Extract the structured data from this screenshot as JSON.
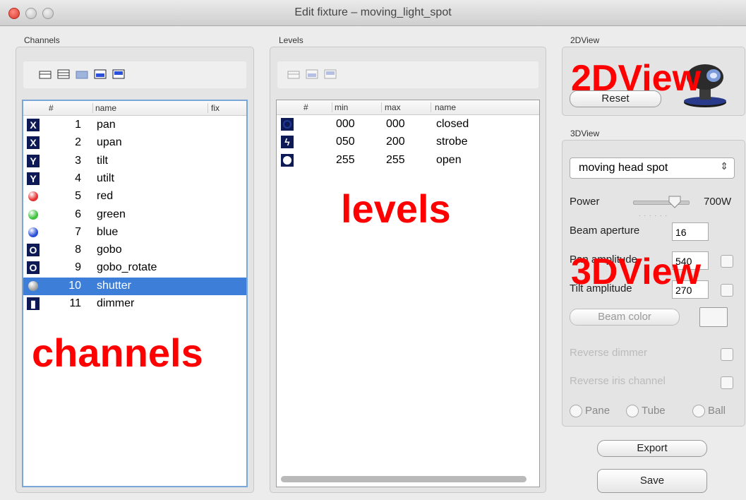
{
  "window": {
    "title": "Edit fixture – moving_light_spot"
  },
  "channels": {
    "group_label": "Channels",
    "columns": [
      "#",
      "name",
      "fix"
    ],
    "rows": [
      {
        "num": "1",
        "name": "pan",
        "icon": "x-axis-icon",
        "glyph": "X"
      },
      {
        "num": "2",
        "name": "upan",
        "icon": "x-fine-icon",
        "glyph": "X"
      },
      {
        "num": "3",
        "name": "tilt",
        "icon": "y-axis-icon",
        "glyph": "Y"
      },
      {
        "num": "4",
        "name": "utilt",
        "icon": "y-fine-icon",
        "glyph": "Y"
      },
      {
        "num": "5",
        "name": "red",
        "icon": "red-ball-icon",
        "color": "#e53030"
      },
      {
        "num": "6",
        "name": "green",
        "icon": "green-ball-icon",
        "color": "#3cc23c"
      },
      {
        "num": "7",
        "name": "blue",
        "icon": "blue-ball-icon",
        "color": "#2a4fd8"
      },
      {
        "num": "8",
        "name": "gobo",
        "icon": "gobo-icon",
        "glyph": "O"
      },
      {
        "num": "9",
        "name": "gobo_rotate",
        "icon": "gobo-rotate-icon",
        "glyph": "O"
      },
      {
        "num": "10",
        "name": "shutter",
        "icon": "shutter-icon",
        "selected": true
      },
      {
        "num": "11",
        "name": "dimmer",
        "icon": "dimmer-icon",
        "glyph": "▮"
      }
    ],
    "overlay_label": "channels"
  },
  "levels": {
    "group_label": "Levels",
    "columns": [
      "#",
      "min",
      "max",
      "name"
    ],
    "rows": [
      {
        "min": "000",
        "max": "000",
        "name": "closed",
        "icon": "closed-icon"
      },
      {
        "min": "050",
        "max": "200",
        "name": "strobe",
        "icon": "strobe-icon"
      },
      {
        "min": "255",
        "max": "255",
        "name": "open",
        "icon": "open-icon"
      }
    ],
    "overlay_label": "levels"
  },
  "view2d": {
    "group_label": "2DView",
    "reset_label": "Reset",
    "overlay_label": "2DView"
  },
  "view3d": {
    "group_label": "3DView",
    "model_select": "moving head spot",
    "power_label": "Power",
    "power_value": "700W",
    "power_level": 0.8,
    "beam_aperture_label": "Beam aperture",
    "beam_aperture_value": "16",
    "pan_amplitude_label": "Pan amplitude",
    "pan_amplitude_value": "540",
    "tilt_amplitude_label": "Tilt amplitude",
    "tilt_amplitude_value": "270",
    "beam_color_label": "Beam color",
    "reverse_dimmer_label": "Reverse dimmer",
    "reverse_iris_label": "Reverse iris channel",
    "radio_pane": "Pane",
    "radio_tube": "Tube",
    "radio_ball": "Ball",
    "overlay_label": "3DView"
  },
  "actions": {
    "export_label": "Export",
    "save_label": "Save"
  },
  "colors": {
    "selection": "#3d7fd8",
    "annotation": "#ff0000"
  }
}
